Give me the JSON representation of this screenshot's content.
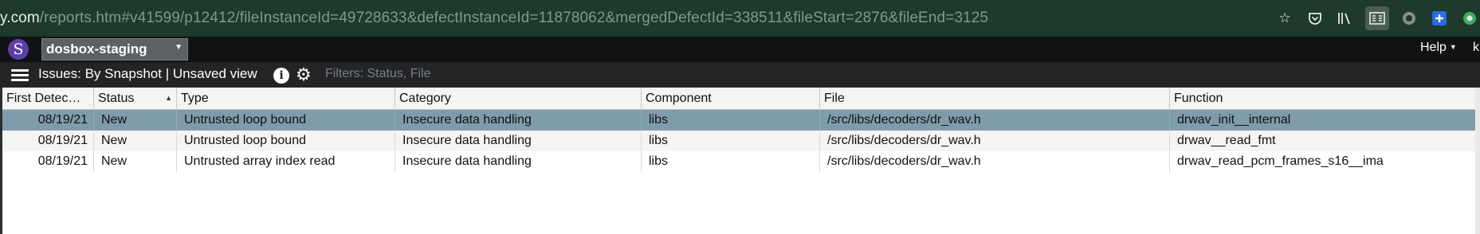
{
  "browser": {
    "url_host": "y.com",
    "url_path": "/reports.htm#v41599/p12412/fileInstanceId=49728633&defectInstanceId=11878062&mergedDefectId=338511&fileStart=2876&fileEnd=3125",
    "icons": [
      "star-icon",
      "pocket-icon",
      "library-icon",
      "reader-view-icon",
      "firefox-account-icon",
      "extension-plus-icon",
      "extension-green-icon"
    ]
  },
  "app": {
    "logo_letter": "S",
    "project": "dosbox-staging",
    "help": "Help",
    "user_initial": "k"
  },
  "toolbar": {
    "view_title": "Issues: By Snapshot | Unsaved view",
    "info_glyph": "i",
    "filters": "Filters: Status, File"
  },
  "table": {
    "columns": [
      "First Detec…",
      "Status",
      "Type",
      "Category",
      "Component",
      "File",
      "Function"
    ],
    "sorted_column": "Status",
    "rows": [
      {
        "first_detected": "08/19/21",
        "status": "New",
        "type": "Untrusted loop bound",
        "category": "Insecure data handling",
        "component": "libs",
        "file": "/src/libs/decoders/dr_wav.h",
        "function": "drwav_init__internal",
        "selected": true
      },
      {
        "first_detected": "08/19/21",
        "status": "New",
        "type": "Untrusted loop bound",
        "category": "Insecure data handling",
        "component": "libs",
        "file": "/src/libs/decoders/dr_wav.h",
        "function": "drwav__read_fmt",
        "selected": false
      },
      {
        "first_detected": "08/19/21",
        "status": "New",
        "type": "Untrusted array index read",
        "category": "Insecure data handling",
        "component": "libs",
        "file": "/src/libs/decoders/dr_wav.h",
        "function": "drwav_read_pcm_frames_s16__ima",
        "selected": false
      }
    ]
  },
  "colors": {
    "url_bar_bg": "#1d3a2c",
    "selected_row": "#7f9cab",
    "logo": "#5a3fa8"
  }
}
